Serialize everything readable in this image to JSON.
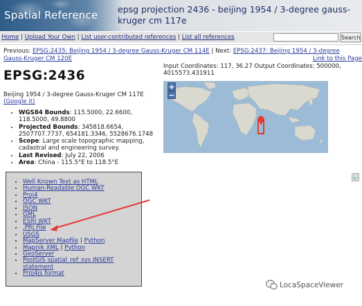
{
  "header": {
    "site_title": "Spatial Reference",
    "page_heading": "epsg projection 2436 - beijing 1954 / 3-degree gauss-kruger cm 117e"
  },
  "nav": {
    "home": "Home",
    "upload": "Upload Your Own",
    "list_user": "List user-contributed references",
    "list_all": "List all references",
    "separator": "|",
    "search_value": "",
    "search_button": "Search"
  },
  "prevnext": {
    "prev_prefix": "Previous: ",
    "prev_link": "EPSG:2435: Beijing 1954 / 3-degree Gauss-Kruger CM 114E",
    "middle": " | Next: ",
    "next_link": "EPSG:2437: Beijing 1954 / 3-degree Gauss-Kruger CM 120E",
    "link_to_page": "Link to this Page"
  },
  "crs": {
    "code_title": "EPSG:2436",
    "name": "Beijing 1954 / 3-degree Gauss-Kruger CM 117E",
    "google_link": "(Google it)",
    "wgs84_label": "WGS84 Bounds",
    "wgs84_value": ": 115.5000, 22.6600, 118.5000, 49.8800",
    "projected_label": "Projected Bounds",
    "projected_value": ": 345818.6654, 2507707.7737, 654181.3346, 5528676.1748",
    "scope_label": "Scope",
    "scope_value": ": Large scale topographic mapping, cadastral and engineering survey.",
    "revised_label": "Last Revised",
    "revised_value": ": July 22, 2006",
    "area_label": "Area",
    "area_value": ": China - 115.5°E to 118.5°E"
  },
  "coords": {
    "text": "Input Coordinates: 117, 36.27 Output Coordinates: 500000, 4015573.431911"
  },
  "map": {
    "zoom_in": "+",
    "zoom_out": "−",
    "ocean_color": "#9bbbd7",
    "land_color": "#d9d9cf",
    "marker_color": "#e8372c"
  },
  "formats": [
    "Well Known Text as HTML",
    "Human-Readable OGC WKT",
    "Proj4",
    "OGC WKT",
    "JSON",
    "GML",
    "ESRI WKT",
    ".PRJ File",
    "USGS",
    "MapServer Mapfile",
    "Python",
    "Mapnik XML",
    "Python",
    "GeoServer",
    "PostGIS spatial_ref_sys INSERT statement",
    "Proj4js format"
  ],
  "annotation": {
    "arrow_color": "#e53a3a"
  },
  "watermark": {
    "text": "LocaSpaceViewer"
  }
}
